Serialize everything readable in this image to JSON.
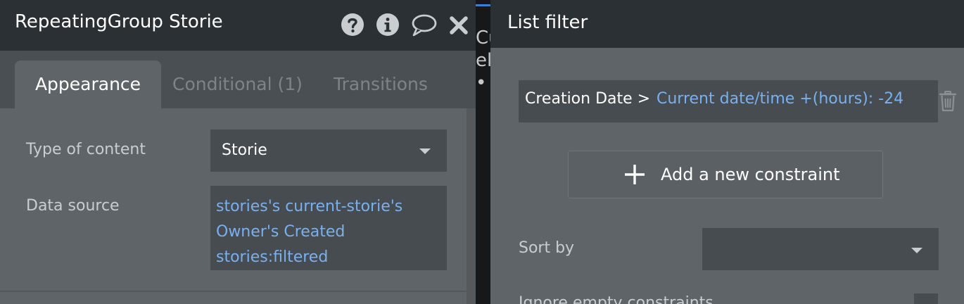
{
  "left_panel": {
    "title": "RepeatingGroup Storie",
    "header_icons": [
      "help-icon",
      "info-icon",
      "comment-icon",
      "close-icon"
    ],
    "tabs": [
      {
        "label": "Appearance",
        "active": true
      },
      {
        "label": "Conditional (1)",
        "active": false
      },
      {
        "label": "Transitions",
        "active": false
      }
    ],
    "type_of_content": {
      "label": "Type of content",
      "value": "Storie"
    },
    "data_source": {
      "label": "Data source",
      "lines": [
        "stories's current-storie's",
        "Owner's Created",
        "stories:filtered"
      ]
    }
  },
  "right_panel": {
    "title": "List filter",
    "constraint": {
      "prefix": "Creation Date >",
      "value": "Current date/time +(hours): -24"
    },
    "add_constraint_label": "Add a new constraint",
    "sort_by": {
      "label": "Sort by",
      "value": ""
    },
    "ignore_empty_label": "Ignore empty constraints"
  },
  "canvas_fragment": {
    "lines": [
      "Cu",
      "el",
      "•"
    ]
  },
  "colors": {
    "panel_bg": "#5f6468",
    "header_bg": "#2b3034",
    "input_bg": "#474c50",
    "link_blue": "#79b0ef",
    "label_gray": "#c9cdd0"
  }
}
